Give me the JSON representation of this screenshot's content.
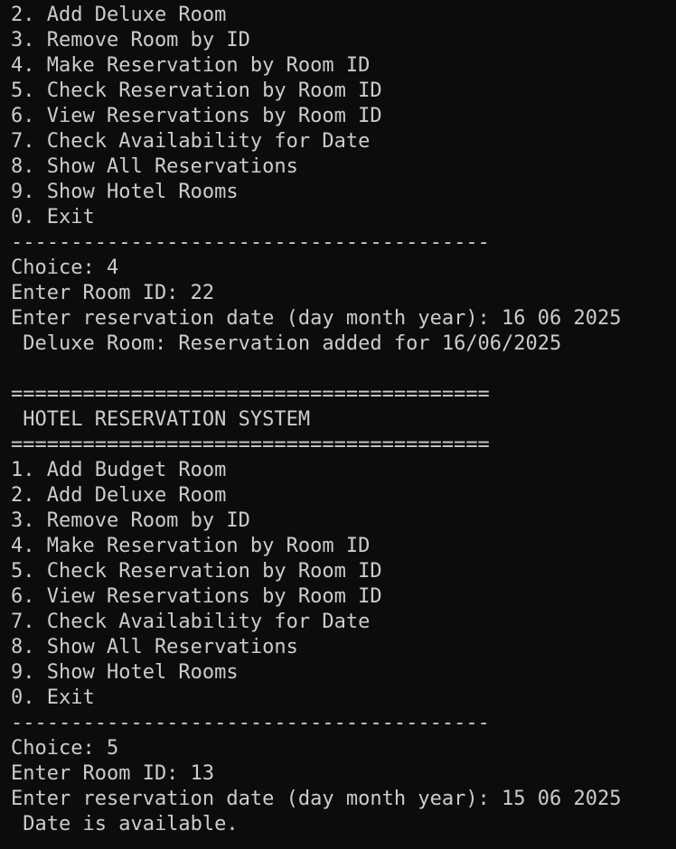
{
  "terminal": {
    "lines": [
      "2. Add Deluxe Room",
      "3. Remove Room by ID",
      "4. Make Reservation by Room ID",
      "5. Check Reservation by Room ID",
      "6. View Reservations by Room ID",
      "7. Check Availability for Date",
      "8. Show All Reservations",
      "9. Show Hotel Rooms",
      "0. Exit",
      "----------------------------------------",
      "Choice: 4",
      "Enter Room ID: 22",
      "Enter reservation date (day month year): 16 06 2025",
      " Deluxe Room: Reservation added for 16/06/2025",
      "",
      "========================================",
      " HOTEL RESERVATION SYSTEM",
      "========================================",
      "1. Add Budget Room",
      "2. Add Deluxe Room",
      "3. Remove Room by ID",
      "4. Make Reservation by Room ID",
      "5. Check Reservation by Room ID",
      "6. View Reservations by Room ID",
      "7. Check Availability for Date",
      "8. Show All Reservations",
      "9. Show Hotel Rooms",
      "0. Exit",
      "----------------------------------------",
      "Choice: 5",
      "Enter Room ID: 13",
      "Enter reservation date (day month year): 15 06 2025",
      " Date is available."
    ]
  },
  "colors": {
    "background": "#0c0c0c",
    "text": "#cccccc"
  }
}
